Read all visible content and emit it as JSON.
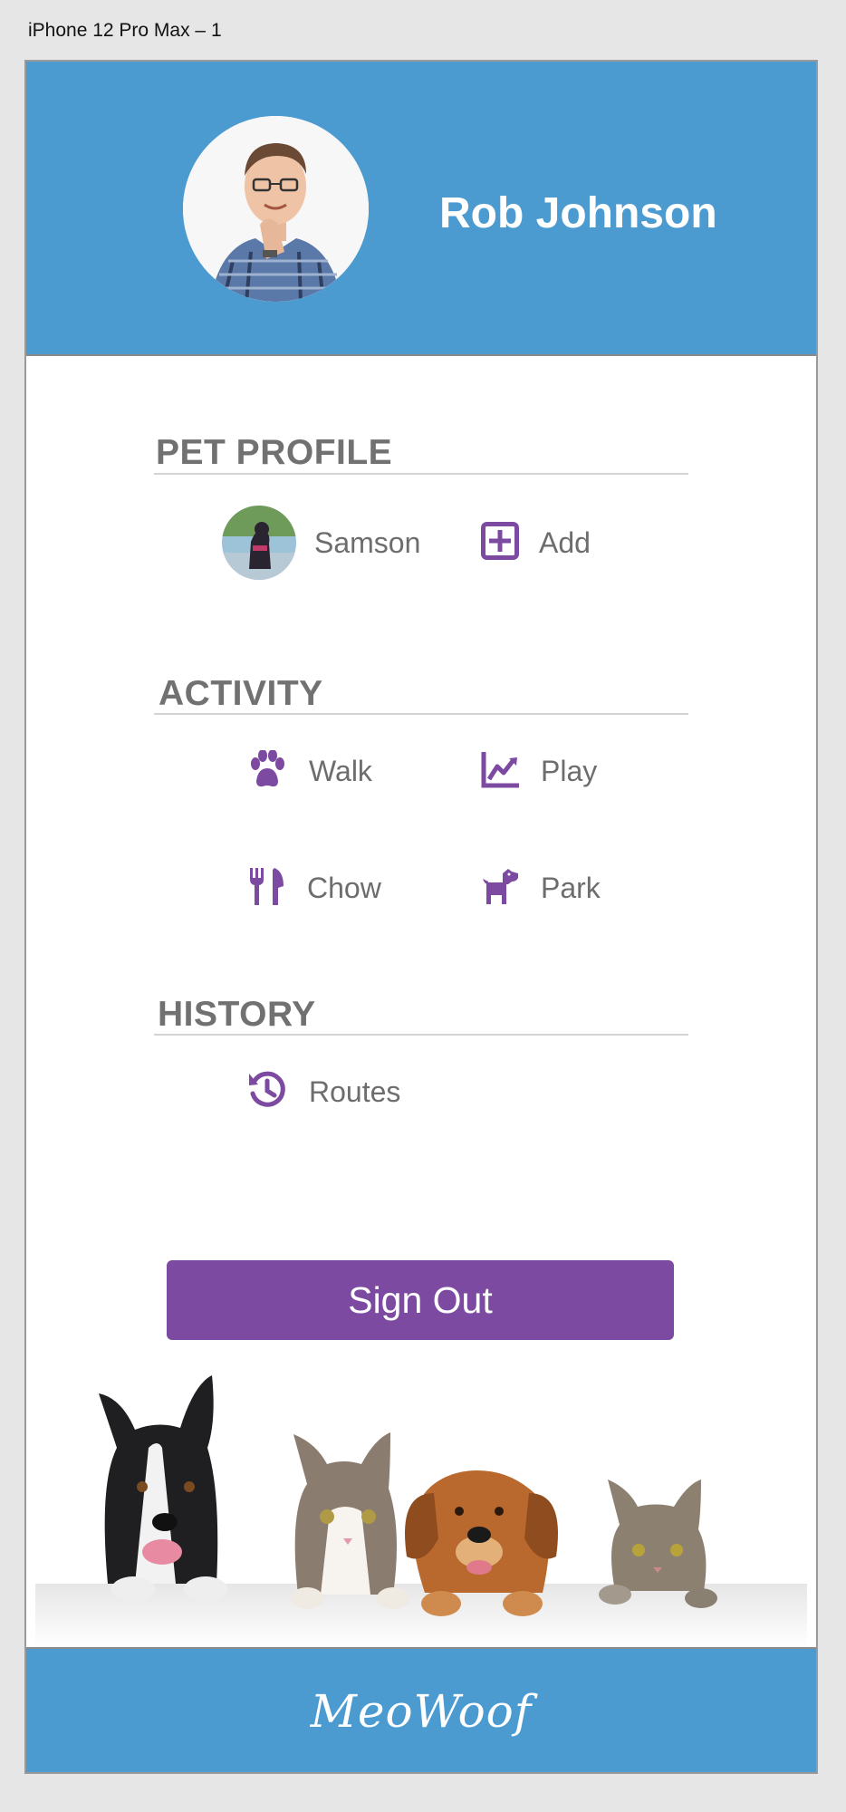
{
  "artboard": {
    "label": "iPhone 12 Pro Max – 1"
  },
  "header": {
    "user_name": "Rob Johnson"
  },
  "pet_profile": {
    "title": "PET PROFILE",
    "pets": [
      {
        "name": "Samson"
      }
    ],
    "add_label": "Add"
  },
  "activity": {
    "title": "ACTIVITY",
    "items": [
      {
        "label": "Walk",
        "icon": "paw-icon"
      },
      {
        "label": "Play",
        "icon": "chart-line-icon"
      },
      {
        "label": "Chow",
        "icon": "utensils-icon"
      },
      {
        "label": "Park",
        "icon": "dog-icon"
      }
    ]
  },
  "history": {
    "title": "HISTORY",
    "items": [
      {
        "label": "Routes",
        "icon": "history-icon"
      }
    ]
  },
  "sign_out_label": "Sign Out",
  "footer": {
    "brand": "MeoWoof"
  },
  "colors": {
    "header_blue": "#4b9bd1",
    "accent_purple": "#7d4aa1",
    "text_gray": "#6d6d6d"
  }
}
